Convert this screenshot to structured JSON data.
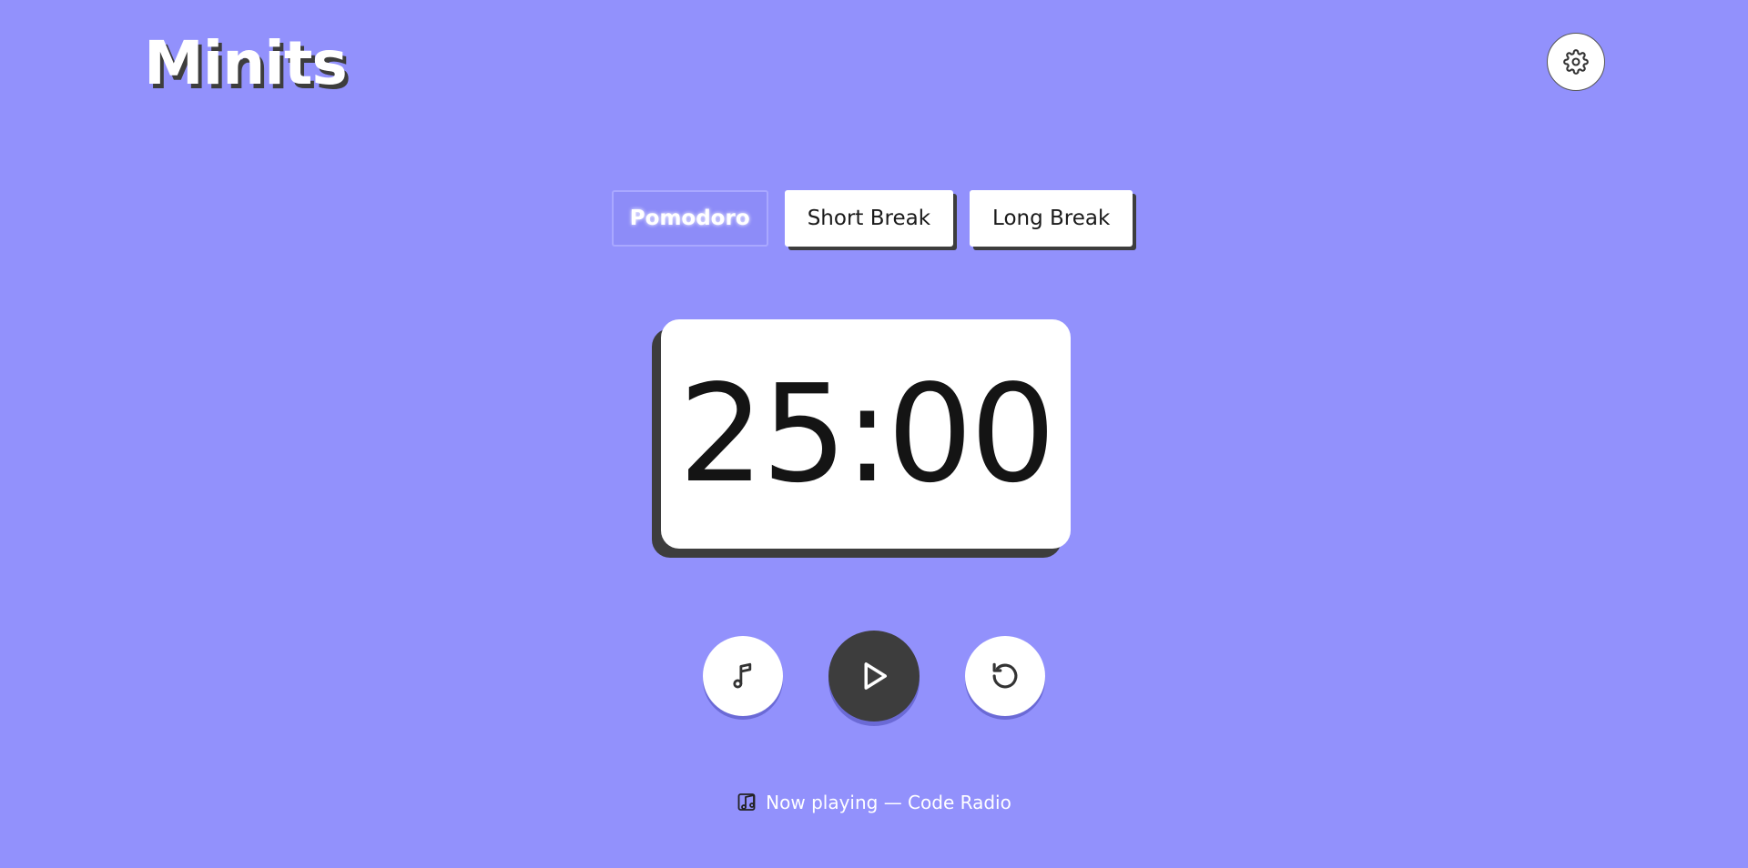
{
  "app": {
    "logo_text": "Minits"
  },
  "header": {
    "settings_icon": "gear-icon"
  },
  "modes": {
    "items": [
      {
        "label": "Pomodoro",
        "active": true
      },
      {
        "label": "Short Break",
        "active": false
      },
      {
        "label": "Long Break",
        "active": false
      }
    ]
  },
  "timer": {
    "display": "25:00"
  },
  "controls": {
    "music_icon": "music-note-icon",
    "play_icon": "play-icon",
    "reset_icon": "reset-icon"
  },
  "footer": {
    "now_playing_icon": "music-notes-icon",
    "now_playing_text": "Now playing — Code Radio"
  },
  "colors": {
    "background": "#9291fc",
    "shadow": "#3d3d3d",
    "card": "#ffffff",
    "active_tab": "#8d8cf8"
  }
}
